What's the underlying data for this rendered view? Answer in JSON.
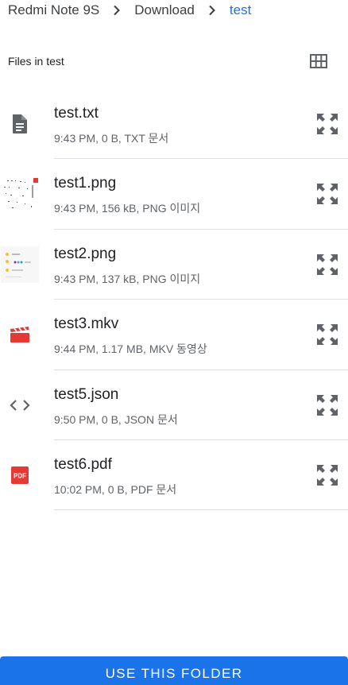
{
  "breadcrumb": {
    "items": [
      "Redmi Note 9S",
      "Download",
      "test"
    ]
  },
  "header": {
    "title": "Files in test",
    "view_toggle_icon": "grid-view-icon"
  },
  "files": [
    {
      "name": "test.txt",
      "meta": "9:43 PM, 0 B, TXT 문서",
      "icon": "text-file-icon"
    },
    {
      "name": "test1.png",
      "meta": "9:43 PM, 156 kB, PNG 이미지",
      "icon": "image-thumbnail"
    },
    {
      "name": "test2.png",
      "meta": "9:43 PM, 137 kB, PNG 이미지",
      "icon": "image-thumbnail"
    },
    {
      "name": "test3.mkv",
      "meta": "9:44 PM, 1.17 MB, MKV 동영상",
      "icon": "video-clapper-icon"
    },
    {
      "name": "test5.json",
      "meta": "9:50 PM, 0 B, JSON 문서",
      "icon": "code-icon"
    },
    {
      "name": "test6.pdf",
      "meta": "10:02 PM, 0 B, PDF 문서",
      "icon": "pdf-icon",
      "icon_label": "PDF"
    }
  ],
  "footer": {
    "button_label": "USE THIS FOLDER"
  },
  "colors": {
    "accent": "#1a73e8",
    "video_icon": "#e53935",
    "pdf_icon": "#e53935",
    "icon_gray": "#5f6368"
  }
}
